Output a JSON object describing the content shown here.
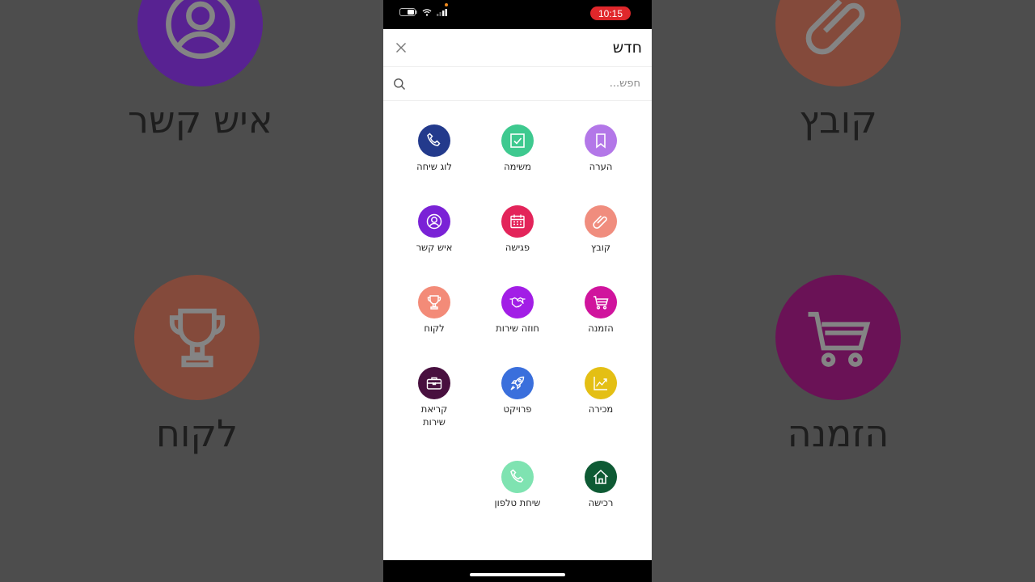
{
  "status_bar": {
    "time": "10:15"
  },
  "sheet": {
    "title": "חדש",
    "search_placeholder": "חפש..."
  },
  "items": [
    {
      "id": "note",
      "label": "הערה",
      "icon": "bookmark-icon",
      "color": "#b377e8"
    },
    {
      "id": "task",
      "label": "משימה",
      "icon": "checkbox-icon",
      "color": "#3ec98f"
    },
    {
      "id": "call-log",
      "label": "לוג שיחה",
      "icon": "phone-icon",
      "color": "#233a8c"
    },
    {
      "id": "file",
      "label": "קובץ",
      "icon": "paperclip-icon",
      "color": "#f08d7e"
    },
    {
      "id": "meeting",
      "label": "פגישה",
      "icon": "calendar-icon",
      "color": "#e3245a"
    },
    {
      "id": "contact",
      "label": "איש קשר",
      "icon": "user-icon",
      "color": "#7a22d6"
    },
    {
      "id": "order",
      "label": "הזמנה",
      "icon": "cart-icon",
      "color": "#d0149d"
    },
    {
      "id": "service-contract",
      "label": "חוזה שירות",
      "icon": "handshake-icon",
      "color": "#a21ee6"
    },
    {
      "id": "customer",
      "label": "לקוח",
      "icon": "trophy-icon",
      "color": "#f38b78"
    },
    {
      "id": "sale",
      "label": "מכירה",
      "icon": "chart-up-icon",
      "color": "#e4bf14"
    },
    {
      "id": "project",
      "label": "פרויקט",
      "icon": "rocket-icon",
      "color": "#3a6fdc"
    },
    {
      "id": "service-call",
      "label": "קריאת שירות",
      "icon": "briefcase-icon",
      "color": "#48103f"
    },
    {
      "id": "purchase",
      "label": "רכישה",
      "icon": "house-icon",
      "color": "#0e5a34"
    },
    {
      "id": "phone-call",
      "label": "שיחת טלפון",
      "icon": "phone-icon",
      "color": "#7fe3b1"
    }
  ],
  "background": {
    "top_left_label": "איש קשר",
    "top_right_label": "קובץ",
    "bottom_left_label": "לקוח",
    "bottom_right_label": "הזמנה"
  }
}
